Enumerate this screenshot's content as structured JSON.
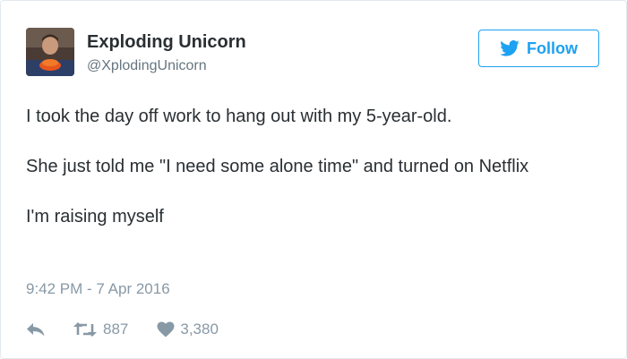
{
  "tweet": {
    "author_name": "Exploding Unicorn",
    "author_handle": "@XplodingUnicorn",
    "follow_label": "Follow",
    "paragraphs": [
      "I took the day off work to hang out with my 5-year-old.",
      "She just told me \"I need some alone time\" and turned on Netflix",
      "I'm raising myself"
    ],
    "timestamp": "9:42 PM - 7 Apr 2016",
    "retweets": "887",
    "likes": "3,380"
  },
  "icons": {
    "follow": "twitter-bird-icon",
    "reply": "reply-icon",
    "retweet": "retweet-icon",
    "like": "heart-icon"
  },
  "colors": {
    "accent": "#1da1f2",
    "text": "#292f33",
    "secondary": "#66757f",
    "meta": "#8899a6",
    "border": "#e1e8ed"
  }
}
